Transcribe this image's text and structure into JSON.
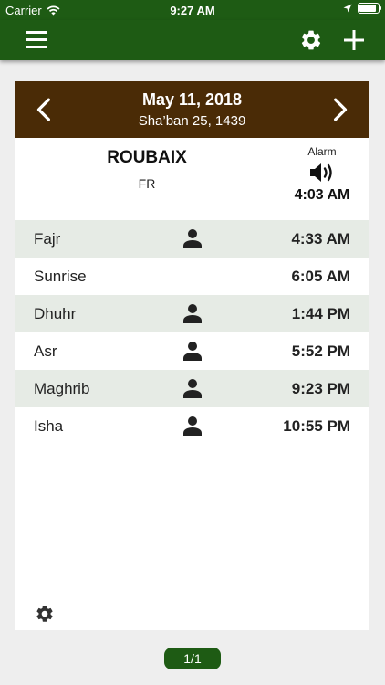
{
  "status_bar": {
    "carrier": "Carrier",
    "time": "9:27 AM"
  },
  "nav": {
    "icons": [
      "menu-icon",
      "settings-gear-icon",
      "add-plus-icon"
    ]
  },
  "date": {
    "gregorian": "May 11, 2018",
    "hijri": "Sha’ban 25, 1439"
  },
  "location": {
    "city": "ROUBAIX",
    "country": "FR"
  },
  "alarm": {
    "label": "Alarm",
    "time": "4:03 AM",
    "icon": "speaker-icon"
  },
  "prayers": [
    {
      "name": "Fajr",
      "time": "4:33 AM",
      "has_person_icon": true,
      "shaded": true
    },
    {
      "name": "Sunrise",
      "time": "6:05 AM",
      "has_person_icon": false,
      "shaded": false
    },
    {
      "name": "Dhuhr",
      "time": "1:44 PM",
      "has_person_icon": true,
      "shaded": true
    },
    {
      "name": "Asr",
      "time": "5:52 PM",
      "has_person_icon": true,
      "shaded": false
    },
    {
      "name": "Maghrib",
      "time": "9:23 PM",
      "has_person_icon": true,
      "shaded": true
    },
    {
      "name": "Isha",
      "time": "10:55 PM",
      "has_person_icon": true,
      "shaded": false
    }
  ],
  "pagination": {
    "label": "1/1"
  },
  "colors": {
    "nav_green": "#1e5b14",
    "header_brown": "#4a2b06",
    "row_shade": "#e6ebe5"
  }
}
